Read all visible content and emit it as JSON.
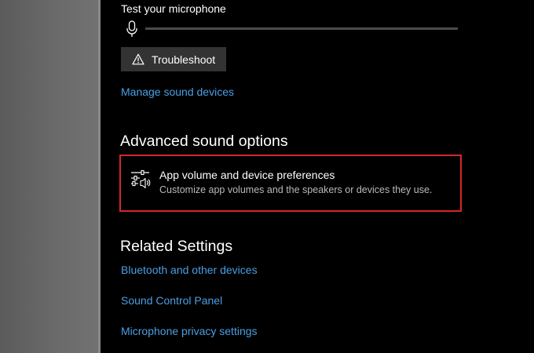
{
  "microphone": {
    "label": "Test your microphone",
    "level": 0
  },
  "troubleshoot": {
    "label": "Troubleshoot"
  },
  "links": {
    "manage_sound_devices": "Manage sound devices"
  },
  "advanced": {
    "title": "Advanced sound options",
    "item": {
      "title": "App volume and device preferences",
      "description": "Customize app volumes and the speakers or devices they use."
    }
  },
  "related": {
    "title": "Related Settings",
    "links": [
      "Bluetooth and other devices",
      "Sound Control Panel",
      "Microphone privacy settings"
    ]
  },
  "colors": {
    "link": "#4a9fe6",
    "highlight_border": "#d6262b",
    "button_bg": "#333333"
  }
}
